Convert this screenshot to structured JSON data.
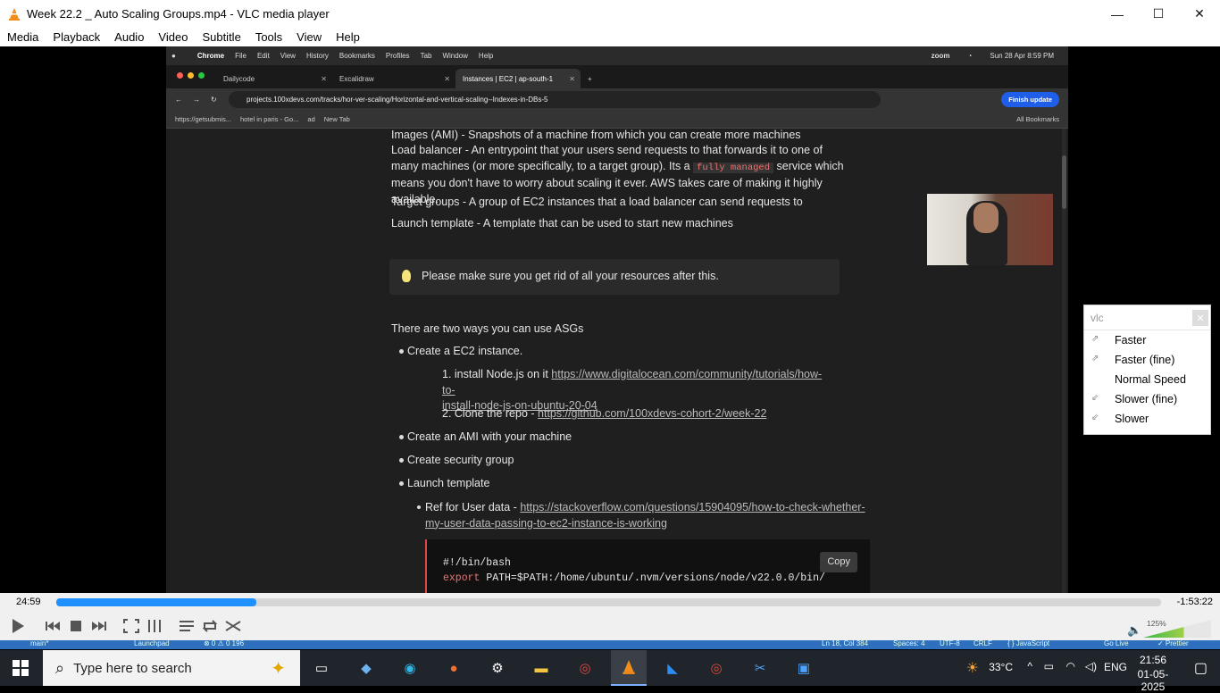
{
  "window": {
    "title": "Week 22.2 _ Auto Scaling Groups.mp4 - VLC media player",
    "min": "—",
    "max": "☐",
    "close": "✕"
  },
  "menu": [
    "Media",
    "Playback",
    "Audio",
    "Video",
    "Subtitle",
    "Tools",
    "View",
    "Help"
  ],
  "mac": {
    "app": "Chrome",
    "menus": [
      "File",
      "Edit",
      "View",
      "History",
      "Bookmarks",
      "Profiles",
      "Tab",
      "Window",
      "Help"
    ],
    "zoom": "zoom",
    "datetime": "Sun 28 Apr  8:59 PM"
  },
  "tabs": [
    {
      "label": "Dailycode"
    },
    {
      "label": "Excalidraw"
    },
    {
      "label": "Instances | EC2 | ap-south-1"
    }
  ],
  "url": "projects.100xdevs.com/tracks/hor-ver-scaling/Horizontal-and-vertical-scaling--Indexes-in-DBs-5",
  "finish_update": "Finish update",
  "bookmarks": [
    "https://getsubmis...",
    "hotel in paris - Go...",
    "ad",
    "New Tab"
  ],
  "all_bookmarks": "All Bookmarks",
  "doc": {
    "ami": "Images (AMI) - Snapshots of a machine from which you can create more machines",
    "lb_pre": "Load balancer - An entrypoint that your users send requests to that forwards it to one of many machines (or more specifically, to a target group). Its a",
    "lb_code": "fully managed",
    "lb_post": "service which means you don't have to worry about scaling it ever. AWS takes care of making it highly available.",
    "tg": "Target groups - A group of EC2 instances that a load balancer can send requests to",
    "lt": "Launch template - A template that can be used to start new machines",
    "callout": "Please make sure you get rid of all your resources after this.",
    "two_ways": "There are two ways you can use ASGs",
    "b1": "Create a EC2 instance.",
    "s1_pre": "1. install Node.js on it",
    "s1_link1": "https://www.digitalocean.com/community/tutorials/how-to-",
    "s1_link2": "install-node-js-on-ubuntu-20-04",
    "s2_pre": "2. Clone the repo -",
    "s2_link": "https://github.com/100xdevs-cohort-2/week-22",
    "b2": "Create an AMI with your machine",
    "b3": "Create security group",
    "b4": "Launch template",
    "ref_pre": "Ref for User data -",
    "ref_link1": "https://stackoverflow.com/questions/15904095/how-to-check-whether-",
    "ref_link2": "my-user-data-passing-to-ec2-instance-is-working",
    "code1": "#!/bin/bash",
    "code2_kw": "export",
    "code2_rest": " PATH=$PATH:/home/ubuntu/.nvm/versions/node/v22.0.0/bin/",
    "copy": "Copy"
  },
  "speed_menu": {
    "input": "vlc",
    "clear": "✕",
    "items": [
      "Faster",
      "Faster (fine)",
      "Normal Speed",
      "Slower (fine)",
      "Slower"
    ]
  },
  "player": {
    "current": "24:59",
    "remaining": "-1:53:22",
    "progress": 0.181,
    "volume": "125%"
  },
  "status": {
    "branch": "main*",
    "launchpad": "Launchpad",
    "errors": "⊗ 0 ⚠ 0  196",
    "pos": "Ln 18, Col 384",
    "spaces": "Spaces: 4",
    "enc": "UTF-8",
    "eol": "CRLF",
    "lang": "{ } JavaScript",
    "golive": "Go Live",
    "prettier": "✓ Prettier"
  },
  "taskbar": {
    "search": "Type here to search",
    "temp": "33°C",
    "lang": "ENG",
    "time": "21:56",
    "date": "01-05-2025"
  }
}
